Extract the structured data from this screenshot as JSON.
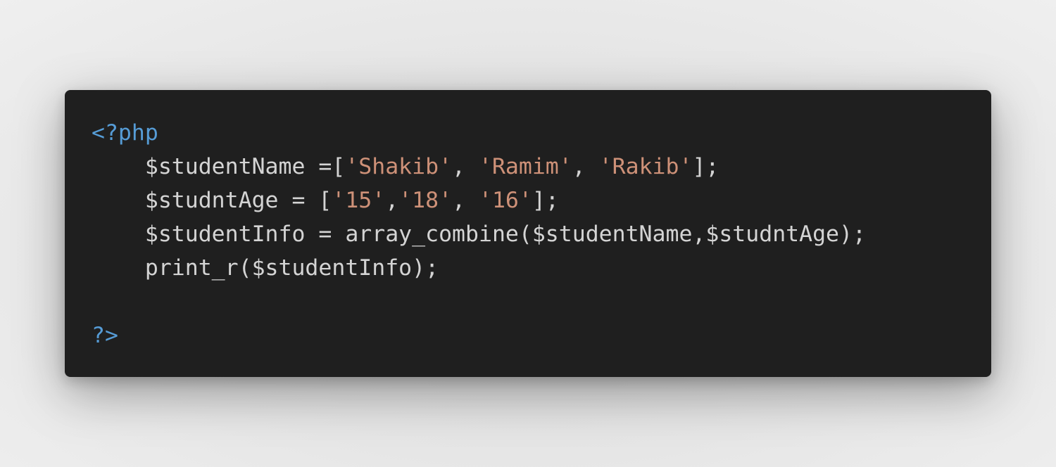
{
  "colors": {
    "background": "#e9e9e9",
    "editor_bg": "#1f1f1f",
    "plain_text": "#d4d4d4",
    "php_tag": "#569cd6",
    "string": "#ce9178"
  },
  "code": {
    "lines": [
      [
        {
          "text": "<?php",
          "kind": "tag"
        }
      ],
      [
        {
          "text": "    $studentName =[",
          "kind": "plain"
        },
        {
          "text": "'Shakib'",
          "kind": "str"
        },
        {
          "text": ", ",
          "kind": "plain"
        },
        {
          "text": "'Ramim'",
          "kind": "str"
        },
        {
          "text": ", ",
          "kind": "plain"
        },
        {
          "text": "'Rakib'",
          "kind": "str"
        },
        {
          "text": "];",
          "kind": "plain"
        }
      ],
      [
        {
          "text": "    $studntAge = [",
          "kind": "plain"
        },
        {
          "text": "'15'",
          "kind": "str"
        },
        {
          "text": ",",
          "kind": "plain"
        },
        {
          "text": "'18'",
          "kind": "str"
        },
        {
          "text": ", ",
          "kind": "plain"
        },
        {
          "text": "'16'",
          "kind": "str"
        },
        {
          "text": "];",
          "kind": "plain"
        }
      ],
      [
        {
          "text": "    $studentInfo = array_combine($studentName,$studntAge);",
          "kind": "plain"
        }
      ],
      [
        {
          "text": "    print_r($studentInfo);",
          "kind": "plain"
        }
      ],
      [],
      [
        {
          "text": "?>",
          "kind": "tag"
        }
      ]
    ]
  }
}
